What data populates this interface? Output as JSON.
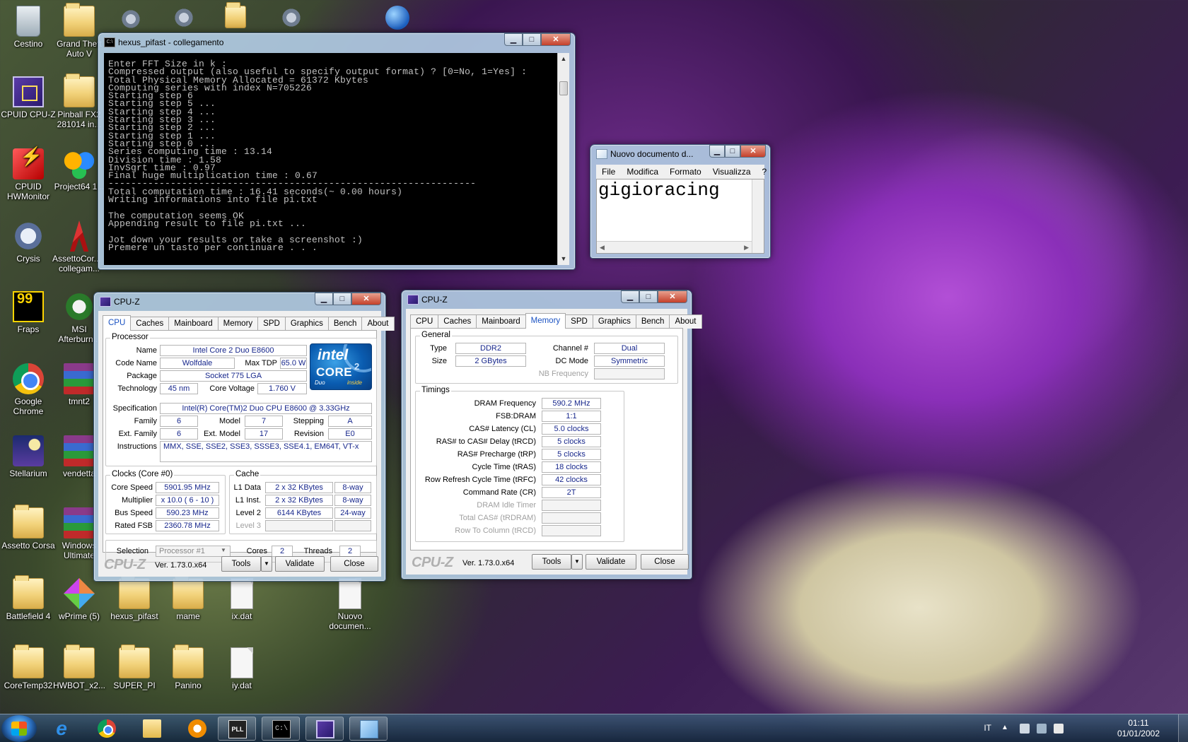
{
  "desktop": {
    "icons": [
      {
        "label": "Cestino",
        "type": "bin"
      },
      {
        "label": "Grand Theft Auto V",
        "type": "folder"
      },
      {
        "label": "CPUID CPU-Z",
        "type": "chip"
      },
      {
        "label": "Pinball FX2 281014 in...",
        "type": "folder"
      },
      {
        "label": "CPUID HWMonitor",
        "type": "red"
      },
      {
        "label": "Project64 1...",
        "type": "butterfly"
      },
      {
        "label": "Crysis",
        "type": "crysis"
      },
      {
        "label": "AssettoCor... - collegam...",
        "type": "ac"
      },
      {
        "label": "Fraps",
        "type": "fraps"
      },
      {
        "label": "MSI Afterburn...",
        "type": "msi"
      },
      {
        "label": "Google Chrome",
        "type": "chrome"
      },
      {
        "label": "tmnt2",
        "type": "rar"
      },
      {
        "label": "Stellarium",
        "type": "stellar"
      },
      {
        "label": "vendetta",
        "type": "rar"
      },
      {
        "label": "Assetto Corsa",
        "type": "folder"
      },
      {
        "label": "Windows Ultimate",
        "type": "rar"
      },
      {
        "label": "Battlefield 4",
        "type": "folder"
      },
      {
        "label": "wPrime (5)",
        "type": "wprime"
      },
      {
        "label": "hexus_pifast",
        "type": "folder"
      },
      {
        "label": "mame",
        "type": "folder"
      },
      {
        "label": "ix.dat",
        "type": "file"
      },
      {
        "label": "Nuovo documen...",
        "type": "file"
      },
      {
        "label": "CoreTemp32",
        "type": "folder"
      },
      {
        "label": "HWBOT_x2...",
        "type": "folder"
      },
      {
        "label": "SUPER_PI",
        "type": "folder"
      },
      {
        "label": "Panino",
        "type": "folder"
      },
      {
        "label": "iy.dat",
        "type": "file"
      }
    ]
  },
  "console": {
    "title": "hexus_pifast - collegamento",
    "text": "Enter FFT Size in k :\nCompressed output (also useful to specify output format) ? [0=No, 1=Yes] :\nTotal Physical Memory Allocated = 61372 Kbytes\nComputing series with index N=705226\nStarting step 6\nStarting step 5 ...\nStarting step 4 ...\nStarting step 3 ...\nStarting step 2 ...\nStarting step 1 ...\nStarting step 0 ...\nSeries computing time : 13.14\nDivision time : 1.58\nInvSqrt time : 0.97\nFinal huge multiplication time : 0.67\n-----------------------------------------------------------------\nTotal computation time : 16.41 seconds(~ 0.00 hours)\nWriting informations into file pi.txt\n\nThe computation seems OK\nAppending result to file pi.txt ...\n\nJot down your results or take a screenshot :)\nPremere un tasto per continuare . . ."
  },
  "notepad": {
    "title": "Nuovo documento d...",
    "menu": [
      "File",
      "Modifica",
      "Formato",
      "Visualizza",
      "?"
    ],
    "content": "gigioracing"
  },
  "cpuz_common": {
    "title": "CPU-Z",
    "tabs": [
      "CPU",
      "Caches",
      "Mainboard",
      "Memory",
      "SPD",
      "Graphics",
      "Bench",
      "About"
    ],
    "logo": "CPU-Z",
    "version": "Ver. 1.73.0.x64",
    "tools": "Tools",
    "validate": "Validate",
    "close": "Close"
  },
  "cpuz_cpu": {
    "active_tab": "CPU",
    "processor_group": "Processor",
    "name_label": "Name",
    "name": "Intel Core 2 Duo E8600",
    "codename_label": "Code Name",
    "codename": "Wolfdale",
    "maxtdp_label": "Max TDP",
    "maxtdp": "65.0 W",
    "package_label": "Package",
    "package": "Socket 775 LGA",
    "tech_label": "Technology",
    "tech": "45 nm",
    "corev_label": "Core Voltage",
    "corev": "1.760 V",
    "spec_label": "Specification",
    "spec": "Intel(R) Core(TM)2 Duo CPU     E8600  @ 3.33GHz",
    "family_label": "Family",
    "family": "6",
    "model_label": "Model",
    "model": "7",
    "stepping_label": "Stepping",
    "stepping": "A",
    "extfamily_label": "Ext. Family",
    "extfamily": "6",
    "extmodel_label": "Ext. Model",
    "extmodel": "17",
    "revision_label": "Revision",
    "revision": "E0",
    "instr_label": "Instructions",
    "instr": "MMX, SSE, SSE2, SSE3, SSSE3, SSE4.1, EM64T, VT-x",
    "intel_badge": {
      "brand": "intel",
      "core": "CORE",
      "num": "2",
      "duo": "Duo",
      "inside": "inside"
    },
    "clocks_group": "Clocks (Core #0)",
    "corespeed_label": "Core Speed",
    "corespeed": "5901.95 MHz",
    "mult_label": "Multiplier",
    "mult": "x 10.0 ( 6 - 10 )",
    "bus_label": "Bus Speed",
    "bus": "590.23 MHz",
    "fsb_label": "Rated FSB",
    "fsb": "2360.78 MHz",
    "cache_group": "Cache",
    "l1d_label": "L1 Data",
    "l1d": "2 x 32 KBytes",
    "l1d_way": "8-way",
    "l1i_label": "L1 Inst.",
    "l1i": "2 x 32 KBytes",
    "l1i_way": "8-way",
    "l2_label": "Level 2",
    "l2": "6144 KBytes",
    "l2_way": "24-way",
    "l3_label": "Level 3",
    "selection_label": "Selection",
    "selection": "Processor #1",
    "cores_label": "Cores",
    "cores": "2",
    "threads_label": "Threads",
    "threads": "2"
  },
  "cpuz_mem": {
    "active_tab": "Memory",
    "general_group": "General",
    "type_label": "Type",
    "type": "DDR2",
    "size_label": "Size",
    "size": "2 GBytes",
    "channel_label": "Channel #",
    "channel": "Dual",
    "dcmode_label": "DC Mode",
    "dcmode": "Symmetric",
    "nbfreq_label": "NB Frequency",
    "timings_group": "Timings",
    "timings": [
      {
        "label": "DRAM Frequency",
        "value": "590.2 MHz"
      },
      {
        "label": "FSB:DRAM",
        "value": "1:1"
      },
      {
        "label": "CAS# Latency (CL)",
        "value": "5.0 clocks"
      },
      {
        "label": "RAS# to CAS# Delay (tRCD)",
        "value": "5 clocks"
      },
      {
        "label": "RAS# Precharge (tRP)",
        "value": "5 clocks"
      },
      {
        "label": "Cycle Time (tRAS)",
        "value": "18 clocks"
      },
      {
        "label": "Row Refresh Cycle Time (tRFC)",
        "value": "42 clocks"
      },
      {
        "label": "Command Rate (CR)",
        "value": "2T"
      },
      {
        "label": "DRAM Idle Timer",
        "value": ""
      },
      {
        "label": "Total CAS# (tRDRAM)",
        "value": ""
      },
      {
        "label": "Row To Column (tRCD)",
        "value": ""
      }
    ]
  },
  "taskbar": {
    "language": "IT",
    "time": "01:11",
    "date": "01/01/2002",
    "items": [
      {
        "name": "internet-explorer",
        "glyph": "e"
      },
      {
        "name": "chrome",
        "glyph": ""
      },
      {
        "name": "explorer",
        "glyph": ""
      },
      {
        "name": "media-player",
        "glyph": ""
      },
      {
        "name": "pll",
        "glyph": "PLL"
      },
      {
        "name": "cmd",
        "glyph": "C:\\"
      },
      {
        "name": "cpuz",
        "glyph": ""
      },
      {
        "name": "notepad",
        "glyph": ""
      }
    ]
  }
}
